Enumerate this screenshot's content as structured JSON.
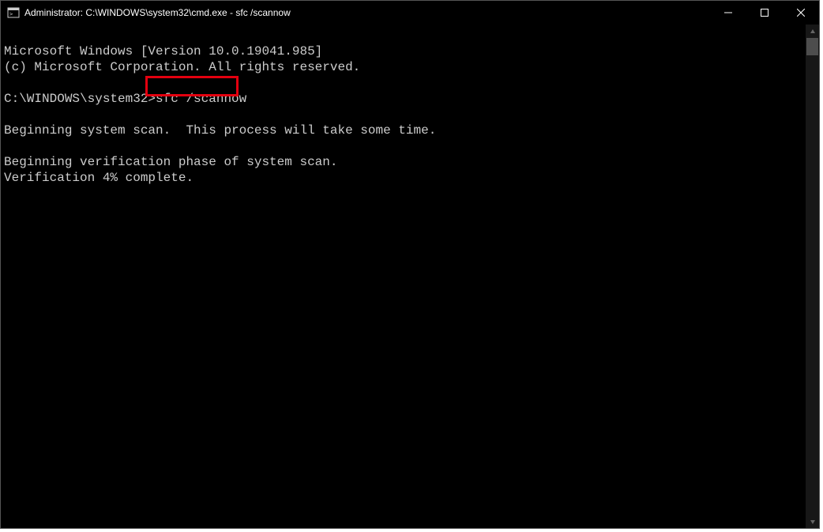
{
  "window": {
    "title": "Administrator: C:\\WINDOWS\\system32\\cmd.exe - sfc  /scannow"
  },
  "terminal": {
    "line1": "Microsoft Windows [Version 10.0.19041.985]",
    "line2": "(c) Microsoft Corporation. All rights reserved.",
    "blank1": "",
    "prompt": "C:\\WINDOWS\\system32>",
    "command": "sfc /scannow",
    "blank2": "",
    "line3": "Beginning system scan.  This process will take some time.",
    "blank3": "",
    "line4": "Beginning verification phase of system scan.",
    "line5": "Verification 4% complete."
  }
}
